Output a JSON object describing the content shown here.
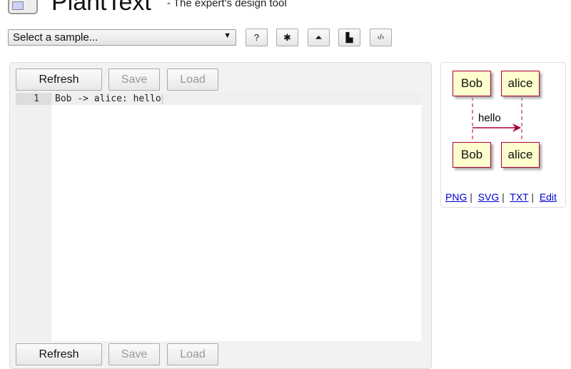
{
  "header": {
    "title": "PlantText",
    "tagline": "- The expert's design tool"
  },
  "toolbar": {
    "sample_select": "Select a sample...",
    "help_label": "?",
    "icons": [
      "gear-icon",
      "upload-icon",
      "file-icon",
      "code-icon"
    ]
  },
  "editor": {
    "refresh": "Refresh",
    "save": "Save",
    "load": "Load",
    "lines": [
      {
        "number": "1",
        "text": "Bob -> alice: hello"
      }
    ]
  },
  "preview": {
    "participants": [
      "Bob",
      "alice"
    ],
    "message": "hello",
    "links": [
      "PNG",
      "SVG",
      "TXT",
      "Edit"
    ],
    "sep": "|"
  }
}
